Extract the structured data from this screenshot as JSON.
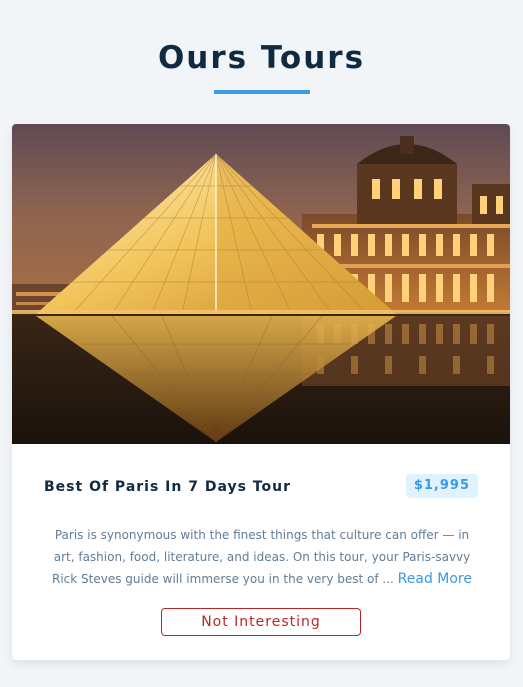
{
  "header": {
    "title": "Ours Tours"
  },
  "tour": {
    "name": "Best Of Paris In 7 Days Tour",
    "price": "$1,995",
    "image_subject": "Louvre pyramid at dusk",
    "description": "Paris is synonymous with the finest things that culture can offer — in art, fashion, food, literature, and ideas. On this tour, your Paris-savvy Rick Steves guide will immerse you in the very best of ...",
    "read_more_label": "Read More",
    "delete_label": "Not Interesting"
  },
  "colors": {
    "background": "#f1f5f8",
    "title": "#102a42",
    "accent": "#3b9ae1",
    "price_bg": "#e0f2fe",
    "body_text": "#617d98",
    "danger": "#bb2525"
  }
}
